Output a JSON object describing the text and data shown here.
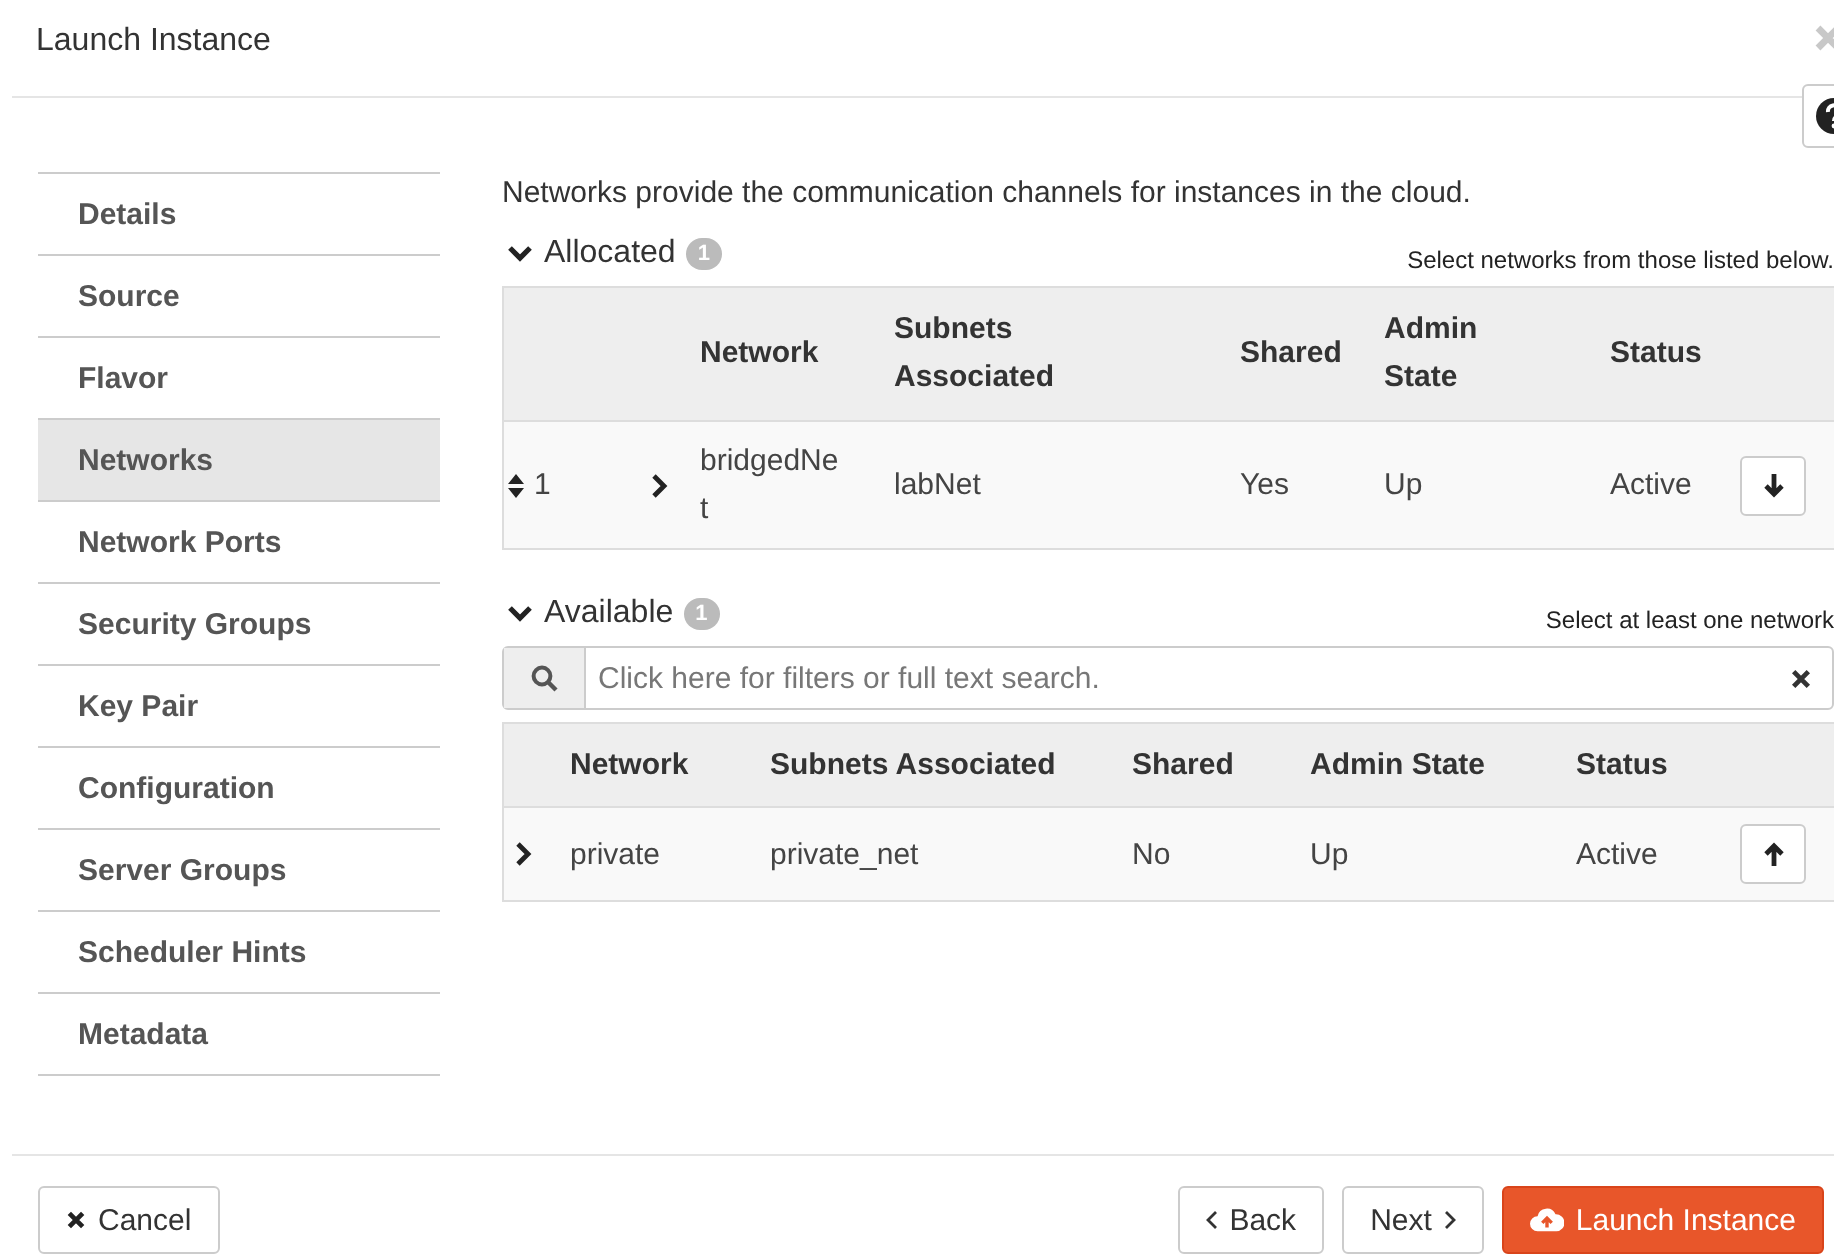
{
  "window": {
    "title": "Launch Instance"
  },
  "sidebar": {
    "items": [
      {
        "label": "Details",
        "selected": false
      },
      {
        "label": "Source",
        "selected": false
      },
      {
        "label": "Flavor",
        "selected": false
      },
      {
        "label": "Networks",
        "selected": true
      },
      {
        "label": "Network Ports",
        "selected": false
      },
      {
        "label": "Security Groups",
        "selected": false
      },
      {
        "label": "Key Pair",
        "selected": false
      },
      {
        "label": "Configuration",
        "selected": false
      },
      {
        "label": "Server Groups",
        "selected": false
      },
      {
        "label": "Scheduler Hints",
        "selected": false
      },
      {
        "label": "Metadata",
        "selected": false
      }
    ]
  },
  "description": "Networks provide the communication channels for instances in the cloud.",
  "allocated": {
    "label": "Allocated",
    "count": "1",
    "hint": "Select networks from those listed below.",
    "expanded": true,
    "columns": [
      "Network",
      "Subnets Associated",
      "Shared",
      "Admin State",
      "Status"
    ],
    "rows": [
      {
        "order": "1",
        "network": "bridgedNet",
        "subnets": "labNet",
        "shared": "Yes",
        "admin_state": "Up",
        "status": "Active"
      }
    ]
  },
  "available": {
    "label": "Available",
    "count": "1",
    "hint": "Select at least one network",
    "expanded": true,
    "search": {
      "placeholder": "Click here for filters or full text search."
    },
    "columns": [
      "Network",
      "Subnets Associated",
      "Shared",
      "Admin State",
      "Status"
    ],
    "rows": [
      {
        "network": "private",
        "subnets": "private_net",
        "shared": "No",
        "admin_state": "Up",
        "status": "Active"
      }
    ]
  },
  "footer": {
    "cancel": "Cancel",
    "back": "Back",
    "next": "Next",
    "launch": "Launch Instance"
  }
}
